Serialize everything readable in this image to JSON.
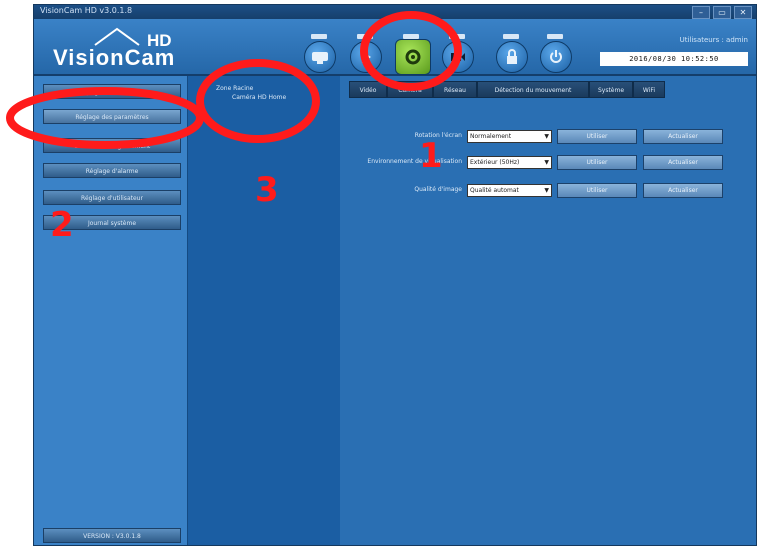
{
  "window": {
    "title": "VisionCam HD v3.0.1.8",
    "controls": [
      "–",
      "▭",
      "✕"
    ]
  },
  "header": {
    "logo_name": "VisionCam",
    "logo_hd": "HD",
    "user_text": "Utilisateurs : admin",
    "datetime": "2016/08/30  10:52:50",
    "toolbar_icons": [
      "camera-icon",
      "play-icon",
      "gear-icon",
      "record-icon",
      "lock-icon",
      "power-icon"
    ]
  },
  "left_nav": {
    "items": [
      "Réglages de la caméra",
      "Réglage des paramètres",
      "Gestion d'enregistrement",
      "Réglage d'alarme",
      "Réglage d'utilisateur",
      "Journal système"
    ],
    "selected_index": 1,
    "version": "VERSION : V3.0.1.8"
  },
  "devices": {
    "group": "Zone Racine",
    "item": "Caméra HD Home"
  },
  "tabs": [
    "Vidéo",
    "Caméra",
    "Réseau",
    "Détection du mouvement",
    "Système",
    "WiFi"
  ],
  "settings": [
    {
      "label": "Rotation l'écran",
      "value": "Normalement",
      "apply": "Utiliser",
      "refresh": "Actualiser"
    },
    {
      "label": "Environnement de visualisation",
      "value": "Extérieur (50Hz)",
      "apply": "Utiliser",
      "refresh": "Actualiser"
    },
    {
      "label": "Qualité d'image",
      "value": "Qualité automat",
      "apply": "Utiliser",
      "refresh": "Actualiser"
    }
  ],
  "annotations": {
    "numbers": [
      "1",
      "2",
      "3"
    ],
    "color": "#ff1b1b"
  },
  "colors": {
    "panel_blue": "#2a6fb3",
    "device_panel": "#1b5ea3",
    "active_tool": "#7cc13a"
  }
}
